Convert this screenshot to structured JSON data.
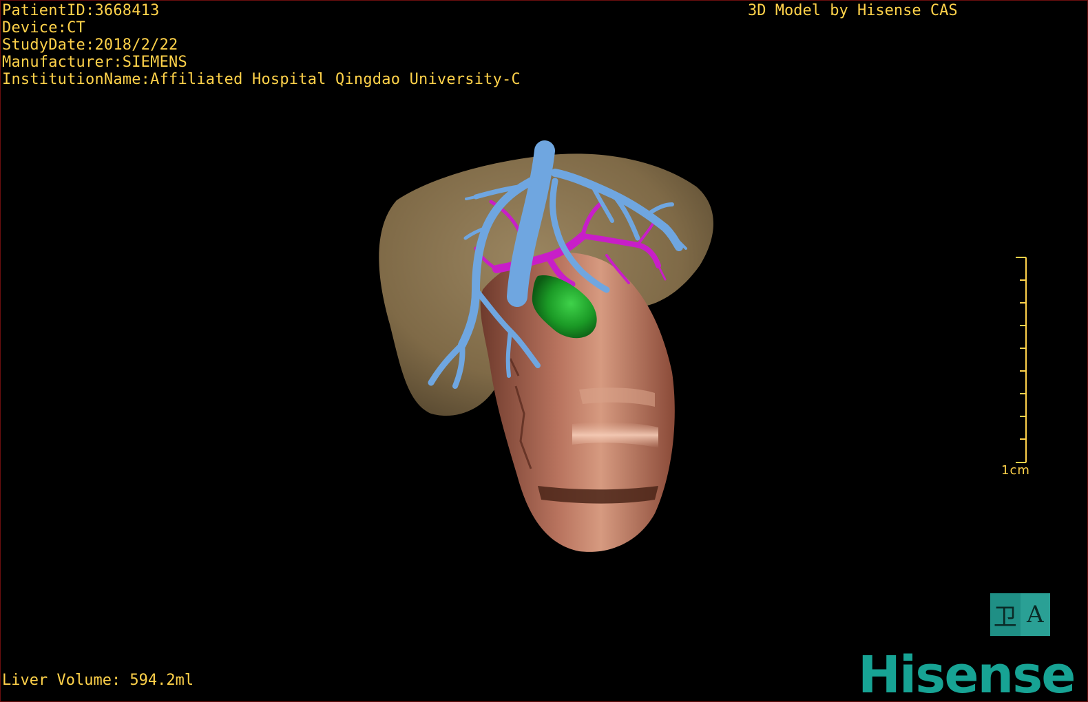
{
  "info": {
    "patient_id": "PatientID:3668413",
    "device": "Device:CT",
    "study_date": "StudyDate:2018/2/22",
    "manufacturer": "Manufacturer:SIEMENS",
    "institution": "InstitutionName:Affiliated Hospital Qingdao University-C"
  },
  "watermark": "3D Model by Hisense CAS",
  "volume": "Liver Volume: 594.2ml",
  "scale": {
    "label": "1cm"
  },
  "orientation": {
    "left_glyph": "卫",
    "right_glyph": "A"
  },
  "logo": "Hisense",
  "colors": {
    "overlay_text": "#ffd24a",
    "liver_left": "#8b7450",
    "liver_right": "#b87560",
    "portal_vein": "#6fa6e0",
    "hepatic_artery": "#c81ec8",
    "tumor": "#1f9a2a",
    "brand": "#17a394"
  }
}
